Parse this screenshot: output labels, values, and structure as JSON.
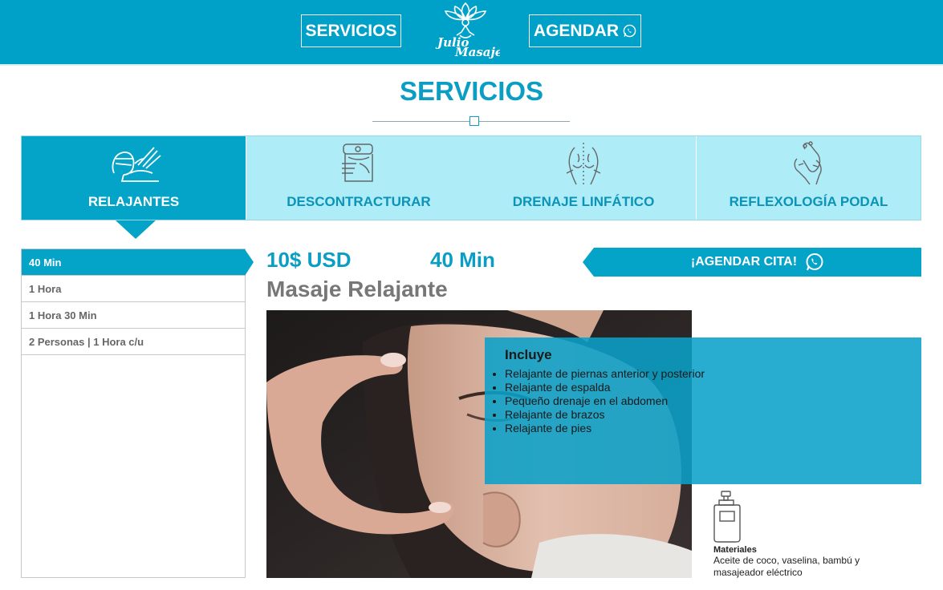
{
  "header": {
    "nav_servicios": "SERVICIOS",
    "nav_agendar": "AGENDAR",
    "logo_text": "Julio Masajes",
    "bg_color": "#00a1c9"
  },
  "section": {
    "title": "SERVICIOS"
  },
  "tabs": [
    {
      "label": "RELAJANTES",
      "icon": "massage-icon",
      "active": true
    },
    {
      "label": "DESCONTRACTURAR",
      "icon": "back-massage-icon",
      "active": false
    },
    {
      "label": "DRENAJE LINFÁTICO",
      "icon": "spine-back-icon",
      "active": false
    },
    {
      "label": "REFLEXOLOGÍA PODAL",
      "icon": "foot-massage-icon",
      "active": false
    }
  ],
  "durations": [
    {
      "label": "40 Min",
      "active": true
    },
    {
      "label": "1 Hora",
      "active": false
    },
    {
      "label": "1 Hora 30 Min",
      "active": false
    },
    {
      "label": "2 Personas | 1 Hora c/u",
      "active": false
    }
  ],
  "detail": {
    "price": "10$ USD",
    "duration": "40 Min",
    "book_label": "¡AGENDAR CITA!",
    "title": "Masaje Relajante",
    "includes_title": "Incluye",
    "includes": [
      "Relajante de piernas anterior y posterior",
      "Relajante de espalda",
      "Pequeño drenaje en el abdomen",
      "Relajante de brazos",
      "Relajante de pies"
    ],
    "materials_title": "Materiales",
    "materials_text": "Aceite de coco, vaselina, bambú y masajeador eléctrico"
  },
  "colors": {
    "accent": "#04a3c8",
    "tab_inactive": "#aeecf8",
    "title_gray": "#777777"
  }
}
